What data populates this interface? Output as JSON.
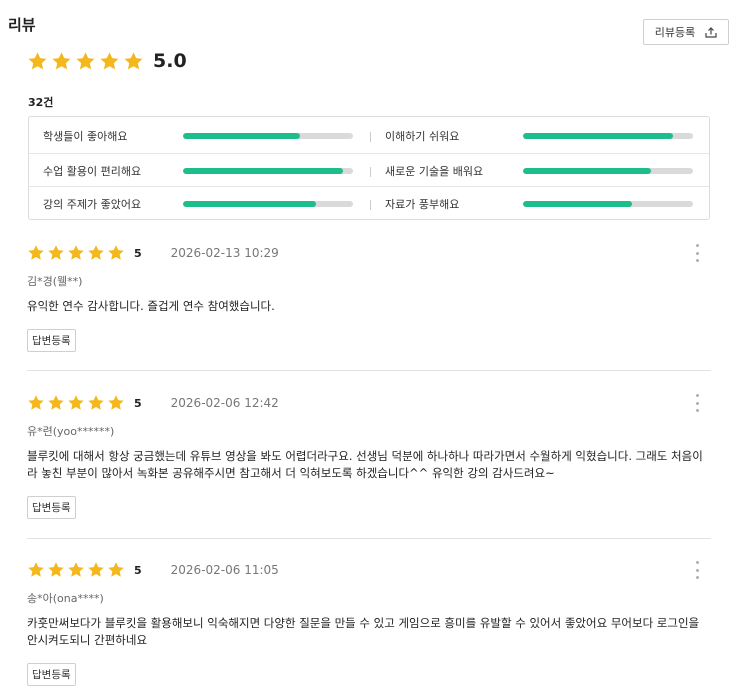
{
  "header": {
    "title": "리뷰",
    "register_button": "리뷰등록",
    "register_icon": "upload-icon"
  },
  "summary": {
    "rating": 5.0,
    "rating_text": "5.0",
    "star_count": 5,
    "review_count": "32건"
  },
  "colors": {
    "star": "#f5b81c",
    "bar_fill": "#1ebd8c",
    "bar_track": "#dadada"
  },
  "features": [
    {
      "label": "학생들이 좋아해요",
      "score": 0.69
    },
    {
      "label": "이해하기 쉬워요",
      "score": 0.88
    },
    {
      "label": "수업 활용이 편리해요",
      "score": 0.94
    },
    {
      "label": "새로운 기술을 배워요",
      "score": 0.75
    },
    {
      "label": "강의 주제가 좋았어요",
      "score": 0.78
    },
    {
      "label": "자료가 풍부해요",
      "score": 0.64
    }
  ],
  "reviews": [
    {
      "score": "5",
      "date": "2026-02-13 10:29",
      "author": "김*경(웰**)",
      "body": "유익한 연수 감사합니다. 즐겁게 연수 참여했습니다.",
      "reply_label": "답변등록"
    },
    {
      "score": "5",
      "date": "2026-02-06 12:42",
      "author": "유*련(yoo******)",
      "body": "블루킷에 대해서 항상 궁금했는데 유튜브 영상을 봐도 어렵더라구요. 선생님 덕분에 하나하나 따라가면서 수월하게 익혔습니다. 그래도 처음이라 놓친 부분이 많아서 녹화본 공유해주시면 참고해서 더 익혀보도록 하겠습니다^^ 유익한 강의 감사드려요~",
      "reply_label": "답변등록"
    },
    {
      "score": "5",
      "date": "2026-02-06 11:05",
      "author": "송*아(ona****)",
      "body": "카훗만써보다가 블루킷을 활용해보니 익숙해지면 다양한 질문을 만들 수 있고 게임으로 흥미를 유발할 수 있어서 좋았어요 무어보다 로그인을 안시켜도되니 간편하네요",
      "reply_label": "답변등록"
    }
  ]
}
